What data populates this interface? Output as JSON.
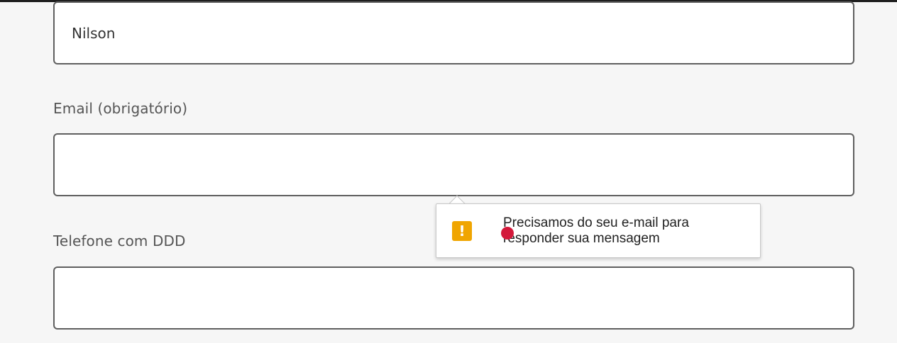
{
  "form": {
    "name_field": {
      "value": "Nilson",
      "placeholder": ""
    },
    "email_label": "Email (obrigatório)",
    "email_field": {
      "value": "",
      "placeholder": ""
    },
    "phone_label": "Telefone com DDD",
    "phone_field": {
      "value": "",
      "placeholder": ""
    }
  },
  "validation_tooltip": {
    "icon": "warning-icon",
    "icon_glyph": "!",
    "icon_color": "#f0a500",
    "message": "Precisamos do seu e-mail para responder sua mensagem"
  },
  "colors": {
    "field_border": "#5f5f5f",
    "label_text": "#555555",
    "page_background": "#f6f6f6",
    "cursor_marker": "#d3183a"
  }
}
